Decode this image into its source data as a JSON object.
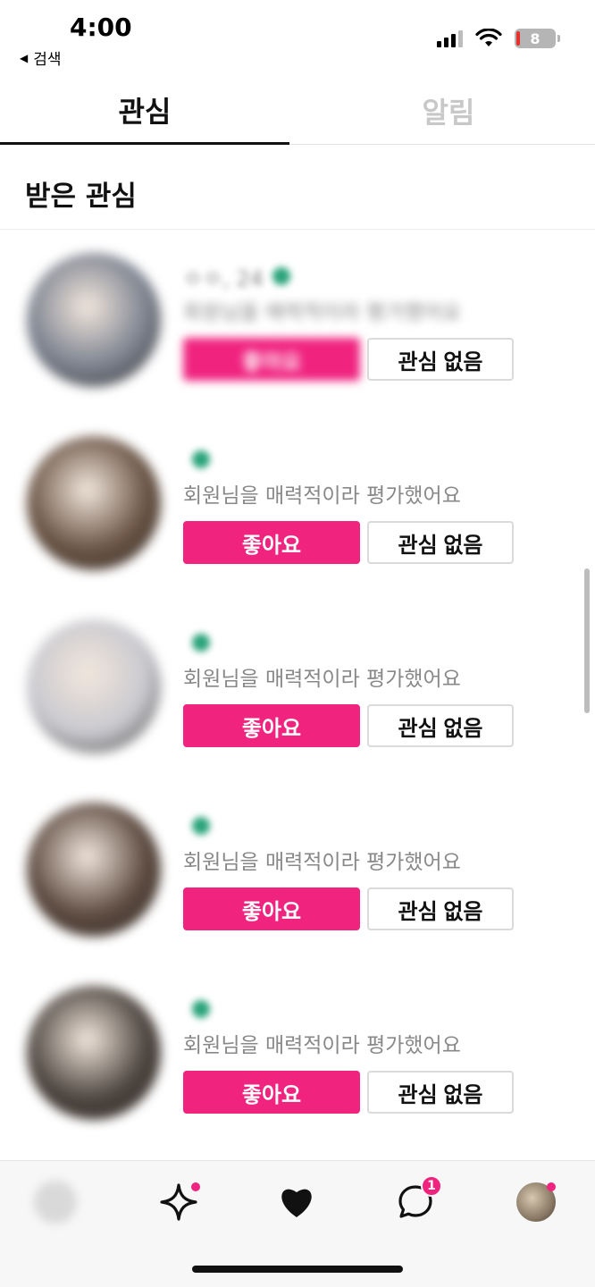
{
  "status_bar": {
    "time": "4:00",
    "back_label": "검색",
    "battery": "8"
  },
  "tabs": [
    {
      "label": "관심"
    },
    {
      "label": "알림"
    }
  ],
  "section": {
    "title": "받은 관심"
  },
  "items": [
    {
      "name": "ㅇㅇ, 24",
      "desc": "회원님을 매력적이라 평가했어요",
      "like_label": "좋아요",
      "pass_label": "관심 없음",
      "avatar_color": "#7d8390"
    },
    {
      "name": "",
      "desc": "회원님을 매력적이라 평가했어요",
      "like_label": "좋아요",
      "pass_label": "관심 없음",
      "avatar_color": "#6b5546"
    },
    {
      "name": "",
      "desc": "회원님을 매력적이라 평가했어요",
      "like_label": "좋아요",
      "pass_label": "관심 없음",
      "avatar_color": "#c9c9cf"
    },
    {
      "name": "",
      "desc": "회원님을 매력적이라 평가했어요",
      "like_label": "좋아요",
      "pass_label": "관심 없음",
      "avatar_color": "#5c4a40"
    },
    {
      "name": "",
      "desc": "회원님을 매력적이라 평가했어요",
      "like_label": "좋아요",
      "pass_label": "관심 없음",
      "avatar_color": "#4e4640"
    }
  ],
  "bottom_nav": {
    "items": [
      {
        "icon": "home-avatar-icon"
      },
      {
        "icon": "sparkle-icon"
      },
      {
        "icon": "heart-icon"
      },
      {
        "icon": "chat-icon"
      },
      {
        "icon": "profile-avatar-icon"
      }
    ],
    "chat_badge": "1"
  },
  "colors": {
    "accent": "#f0237f",
    "verified": "#2aa37a"
  }
}
